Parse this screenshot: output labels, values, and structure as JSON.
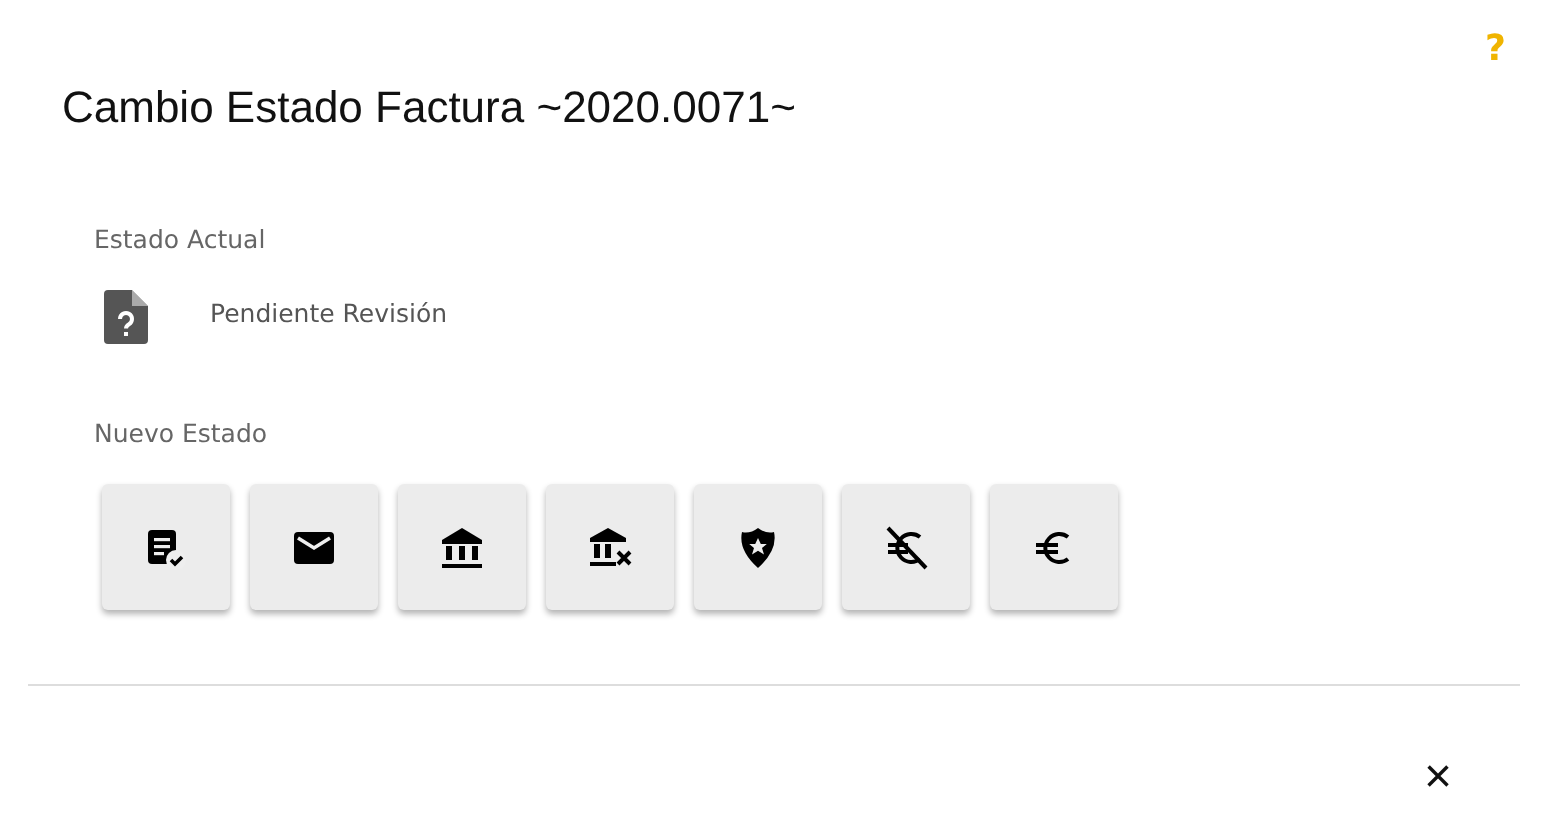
{
  "help": "?",
  "title": "Cambio Estado Factura ~2020.0071~",
  "current": {
    "label": "Estado Actual",
    "status": "Pendiente Revisión"
  },
  "new_state": {
    "label": "Nuevo Estado",
    "buttons": [
      {
        "kind": "invoice-check"
      },
      {
        "kind": "mail"
      },
      {
        "kind": "bank"
      },
      {
        "kind": "bank-x"
      },
      {
        "kind": "shield"
      },
      {
        "kind": "euro-off"
      },
      {
        "kind": "euro"
      }
    ]
  },
  "close": "×"
}
